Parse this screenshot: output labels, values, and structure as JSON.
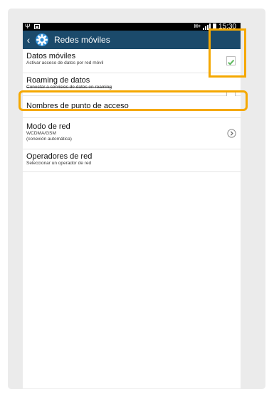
{
  "status_bar": {
    "left_icons": [
      "usb-icon",
      "image-icon"
    ],
    "network_type": "H+",
    "time": "15:30"
  },
  "action_bar": {
    "title": "Redes móviles",
    "back_icon": "chevron-left-icon",
    "app_icon": "settings-gear-icon",
    "background": "#1b4a6b"
  },
  "items": [
    {
      "title": "Datos móviles",
      "subtitle": "Activar acceso de datos por red móvil",
      "control": "checkbox",
      "checked": true
    },
    {
      "title": "Roaming de datos",
      "subtitle": "Conectar a servicios de datos en roaming",
      "control": "checkbox",
      "checked": false
    },
    {
      "title": "Nombres de punto de acceso"
    },
    {
      "title": "Modo de red",
      "subtitle": "WCDMA/GSM",
      "subtitle2": "(conexión automática)",
      "control": "arrow-icon"
    },
    {
      "title": "Operadores de red",
      "subtitle": "Seleccionar un operador de red"
    }
  ],
  "highlight_color": "#f5a800",
  "checkmark_color": "#5cb85c"
}
